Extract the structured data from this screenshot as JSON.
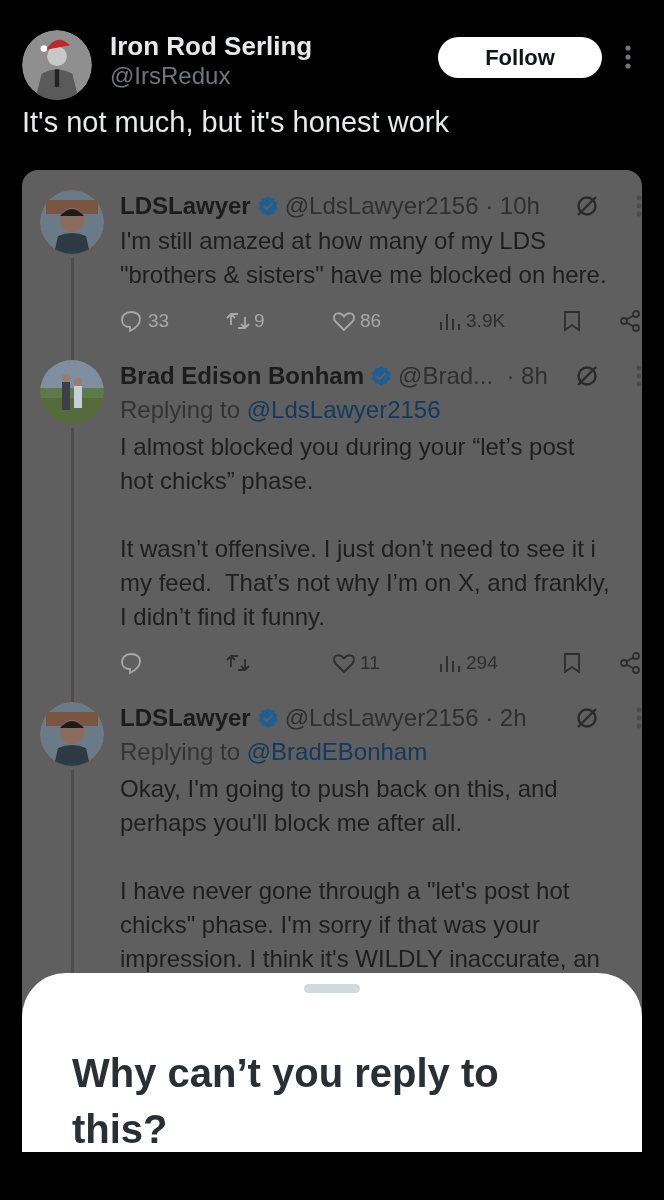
{
  "post": {
    "author": {
      "name": "Iron Rod Serling",
      "handle": "@IrsRedux"
    },
    "follow_button": "Follow",
    "text": "It's not much, but it's honest work"
  },
  "embedded_screenshot": {
    "tweets": [
      {
        "name": "LDSLawyer",
        "meta": "@LdsLawyer2156 · 10h",
        "paragraphs": [
          [
            "I'm still amazed at how many of my LDS",
            "\"brothers & sisters\" have me blocked on here."
          ]
        ],
        "actions": [
          {
            "kind": "reply",
            "count": "33",
            "disabled": true
          },
          {
            "kind": "repost",
            "count": "9",
            "disabled": true
          },
          {
            "kind": "like",
            "count": "86",
            "disabled": true
          },
          {
            "kind": "views",
            "count": "3.9K",
            "disabled": false
          },
          {
            "kind": "bookmark",
            "disabled": false
          },
          {
            "kind": "share",
            "disabled": false
          }
        ]
      },
      {
        "name": "Brad Edison Bonham",
        "meta": "@Brad...  · 8h",
        "replying_label": "Replying to",
        "replying_to": "@LdsLawyer2156",
        "paragraphs": [
          [
            "I almost blocked you during your “let’s post",
            "hot chicks” phase."
          ],
          [
            "It wasn’t offensive. I just don’t need to see it i",
            "my feed.  That’s not why I’m on X, and frankly,",
            "I didn’t find it funny."
          ]
        ],
        "actions": [
          {
            "kind": "reply",
            "disabled": true
          },
          {
            "kind": "repost",
            "disabled": false
          },
          {
            "kind": "like",
            "count": "11",
            "disabled": false
          },
          {
            "kind": "views",
            "count": "294",
            "disabled": false
          },
          {
            "kind": "bookmark",
            "disabled": false
          },
          {
            "kind": "share",
            "disabled": false
          }
        ]
      },
      {
        "name": "LDSLawyer",
        "meta": "@LdsLawyer2156 · 2h",
        "replying_label": "Replying to",
        "replying_to": "@BradEBonham",
        "paragraphs": [
          [
            "Okay, I'm going to push back on this, and",
            "perhaps you'll block me after all."
          ],
          [
            "I have never gone through a \"let's post hot",
            "chicks\" phase. I'm sorry if that was your",
            "impression. I think it's WILDLY inaccurate, an"
          ]
        ]
      }
    ],
    "sheet": {
      "title": "Why can’t you reply to this?"
    }
  }
}
